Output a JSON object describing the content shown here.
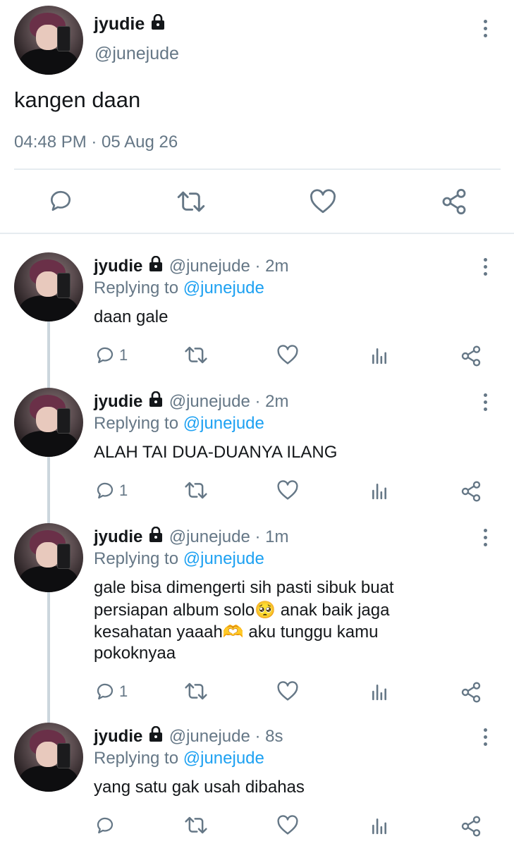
{
  "main_tweet": {
    "display_name": "jyudie",
    "handle": "@junejude",
    "text": "kangen daan",
    "timestamp": "04:48 PM · 05 Aug 26",
    "icons": [
      "reply-icon",
      "retweet-icon",
      "like-icon",
      "share-icon"
    ]
  },
  "replies": [
    {
      "display_name": "jyudie",
      "handle": "@junejude",
      "time": "· 2m",
      "replying_label": "Replying to",
      "replying_handle": "@junejude",
      "lines": [
        "daan gale"
      ],
      "reply_count": "1"
    },
    {
      "display_name": "jyudie",
      "handle": "@junejude",
      "time": "· 2m",
      "replying_label": "Replying to",
      "replying_handle": "@junejude",
      "lines": [
        "ALAH TAI DUA-DUANYA ILANG"
      ],
      "reply_count": "1"
    },
    {
      "display_name": "jyudie",
      "handle": "@junejude",
      "time": "· 1m",
      "replying_label": "Replying to",
      "replying_handle": "@junejude",
      "lines": [
        "gale bisa dimengerti sih pasti sibuk buat",
        "persiapan album solo🥺 anak baik jaga",
        "kesahatan yaaah🫶 aku tunggu kamu",
        "pokoknyaa"
      ],
      "reply_count": "1"
    },
    {
      "display_name": "jyudie",
      "handle": "@junejude",
      "time": "· 8s",
      "replying_label": "Replying to",
      "replying_handle": "@junejude",
      "lines": [
        "yang satu gak usah dibahas"
      ],
      "reply_count": ""
    }
  ],
  "colors": {
    "link": "#1da1f2",
    "muted": "#657786",
    "text": "#14171a",
    "divider": "#e6ecf0"
  }
}
